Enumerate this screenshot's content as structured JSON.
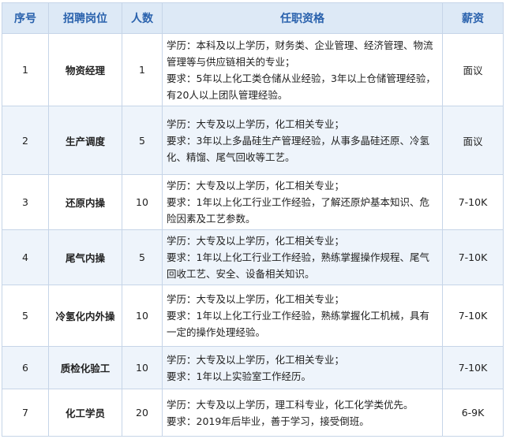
{
  "headers": {
    "index": "序号",
    "position": "招聘岗位",
    "count": "人数",
    "requirements": "任职资格",
    "salary": "薪资"
  },
  "rows": [
    {
      "index": "1",
      "position": "物资经理",
      "count": "1",
      "education": "学历：本科及以上学历，财务类、企业管理、经济管理、物流管理等与供应链相关的专业；",
      "requirement": "要求：5年以上化工类仓储从业经验，3年以上仓储管理经验，有20人以上团队管理经验。",
      "salary": "面议"
    },
    {
      "index": "2",
      "position": "生产调度",
      "count": "5",
      "education": "学历：大专及以上学历，化工相关专业；",
      "requirement": "要求：3年以上多晶硅生产管理经验，从事多晶硅还原、冷氢化、精馏、尾气回收等工艺。",
      "salary": "面议"
    },
    {
      "index": "3",
      "position": "还原内操",
      "count": "10",
      "education": "学历：大专及以上学历，化工相关专业；",
      "requirement": "要求：1年以上化工行业工作经验，了解还原炉基本知识、危险因素及工艺参数。",
      "salary": "7-10K"
    },
    {
      "index": "4",
      "position": "尾气内操",
      "count": "5",
      "education": "学历：大专及以上学历，化工相关专业；",
      "requirement": "要求：1年以上化工行业工作经验，熟练掌握操作规程、尾气回收工艺、安全、设备相关知识。",
      "salary": "7-10K"
    },
    {
      "index": "5",
      "position": "冷氢化内外操",
      "count": "10",
      "education": "学历：大专及以上学历，化工相关专业；",
      "requirement": "要求：1年以上化工行业工作经验，熟练掌握化工机械，具有一定的操作处理经验。",
      "salary": "7-10K"
    },
    {
      "index": "6",
      "position": "质检化验工",
      "count": "10",
      "education": "学历：大专及以上学历，化工相关专业；",
      "requirement": "要求：1年以上实验室工作经历。",
      "salary": "7-10K"
    },
    {
      "index": "7",
      "position": "化工学员",
      "count": "20",
      "education": "学历：大专及以上学历，理工科专业，化工化学类优先。",
      "requirement": "要求：2019年后毕业，善于学习，接受倒班。",
      "salary": "6-9K"
    }
  ]
}
